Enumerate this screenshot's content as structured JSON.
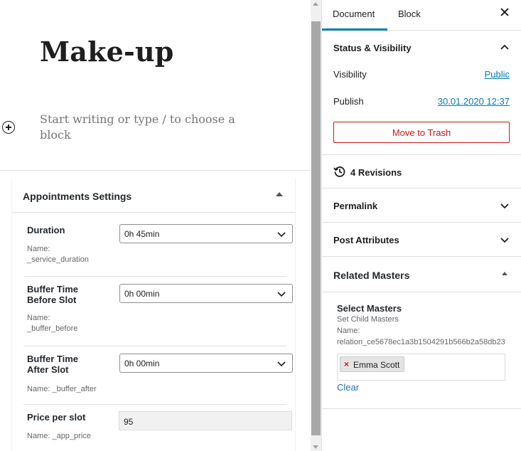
{
  "editor": {
    "title": "Make-up",
    "placeholder": "Start writing or type / to choose a block",
    "metabox": {
      "title": "Appointments Settings",
      "fields": [
        {
          "label": "Duration",
          "name_label": "Name:",
          "name_value": "_service_duration",
          "value": "0h 45min"
        },
        {
          "label": "Buffer Time Before Slot",
          "name_label": "Name:",
          "name_value": "_buffer_before",
          "value": "0h 00min"
        },
        {
          "label": "Buffer Time After Slot",
          "name_text": "Name: _buffer_after",
          "value": "0h 00min"
        },
        {
          "label": "Price per slot",
          "name_text": "Name: _app_price",
          "value": "95"
        }
      ]
    }
  },
  "sidebar": {
    "tabs": [
      "Document",
      "Block"
    ],
    "active_tab": "Document",
    "status": {
      "title": "Status & Visibility",
      "visibility_label": "Visibility",
      "visibility_value": "Public",
      "publish_label": "Publish",
      "publish_value": "30.01.2020 12:37",
      "trash_label": "Move to Trash"
    },
    "revisions": "4 Revisions",
    "permalink": "Permalink",
    "post_attributes": "Post Attributes",
    "related_masters": {
      "title": "Related Masters",
      "select_title": "Select Masters",
      "subtitle": "Set Child Masters",
      "name_label": "Name:",
      "name_value": "relation_ce5678ec1a3b1504291b566b2a58db23",
      "tags": [
        "Emma Scott"
      ],
      "clear_label": "Clear"
    }
  },
  "colors": {
    "accent": "#007cba",
    "danger": "#cc1818",
    "text": "#1e1e1e"
  }
}
